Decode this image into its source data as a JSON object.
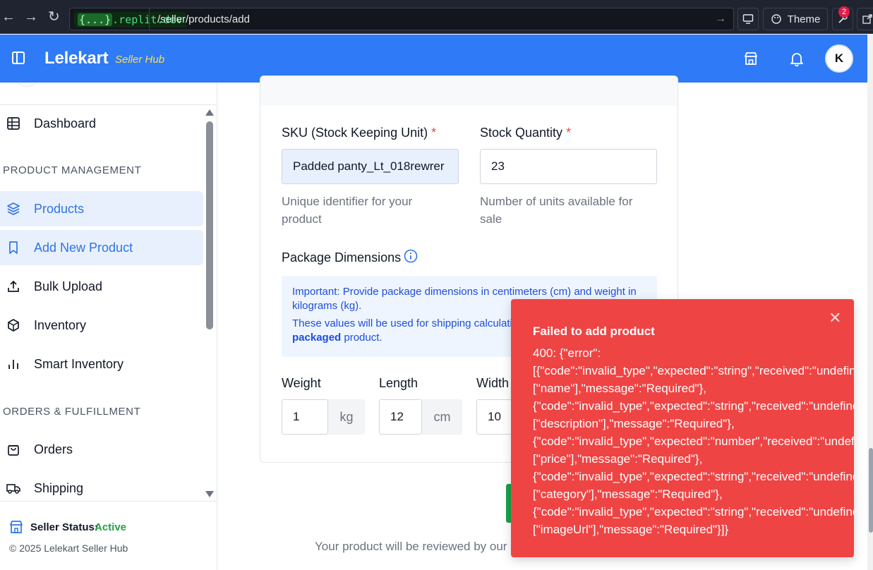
{
  "browser": {
    "url_host_brace": "{...}",
    "url_host": ".replit.dev",
    "url_path": "/seller/products/add",
    "theme_label": "Theme",
    "badge_count": "2"
  },
  "header": {
    "logo": "Lelekart",
    "logo_sub": "Seller Hub",
    "avatar_initial": "K"
  },
  "sidebar": {
    "dashboard": "Dashboard",
    "section_product": "PRODUCT MANAGEMENT",
    "products": "Products",
    "add_new_product": "Add New Product",
    "bulk_upload": "Bulk Upload",
    "inventory": "Inventory",
    "smart_inventory": "Smart Inventory",
    "section_orders": "ORDERS & FULFILLMENT",
    "orders": "Orders",
    "shipping": "Shipping",
    "status_label": "Seller Status:",
    "status_value": "Active",
    "copyright": "© 2025 Lelekart Seller Hub"
  },
  "form": {
    "sku_label": "SKU (Stock Keeping Unit)",
    "sku_value": "Padded panty_Lt_018rewrer",
    "sku_help_1": "Unique identifier for your",
    "sku_help_2": "product",
    "stock_label": "Stock Quantity",
    "stock_value": "23",
    "stock_help_1": "Number of units available for",
    "stock_help_2": "sale",
    "required_mark": "*",
    "package_label": "Package Dimensions",
    "info_line1": "Important: Provide package dimensions in centimeters (cm) and weight in",
    "info_line2": "kilograms (kg).",
    "info_line3": "These values will be used for shipping calculations",
    "info_bold": "packaged",
    "info_line4": " product.",
    "weight_label": "Weight",
    "weight_value": "1",
    "weight_unit": "kg",
    "length_label": "Length",
    "length_value": "12",
    "length_unit": "cm",
    "width_label": "Width",
    "width_value": "10",
    "footer_note": "Your product will be reviewed by our"
  },
  "toast": {
    "title": "Failed to add product",
    "lines": [
      "400: {\"error\":",
      "[{\"code\":\"invalid_type\",\"expected\":\"string\",\"received\":\"undefined\",\"path\":",
      "[\"name\"],\"message\":\"Required\"},",
      "{\"code\":\"invalid_type\",\"expected\":\"string\",\"received\":\"undefined\",\"path\":",
      "[\"description\"],\"message\":\"Required\"},",
      "{\"code\":\"invalid_type\",\"expected\":\"number\",\"received\":\"undefined\",\"path\":",
      "[\"price\"],\"message\":\"Required\"},",
      "{\"code\":\"invalid_type\",\"expected\":\"string\",\"received\":\"undefined\",\"path\":",
      "[\"category\"],\"message\":\"Required\"},",
      "{\"code\":\"invalid_type\",\"expected\":\"string\",\"received\":\"undefined\",\"path\":",
      "[\"imageUrl\"],\"message\":\"Required\"}]}"
    ],
    "close_glyph": "✕"
  }
}
